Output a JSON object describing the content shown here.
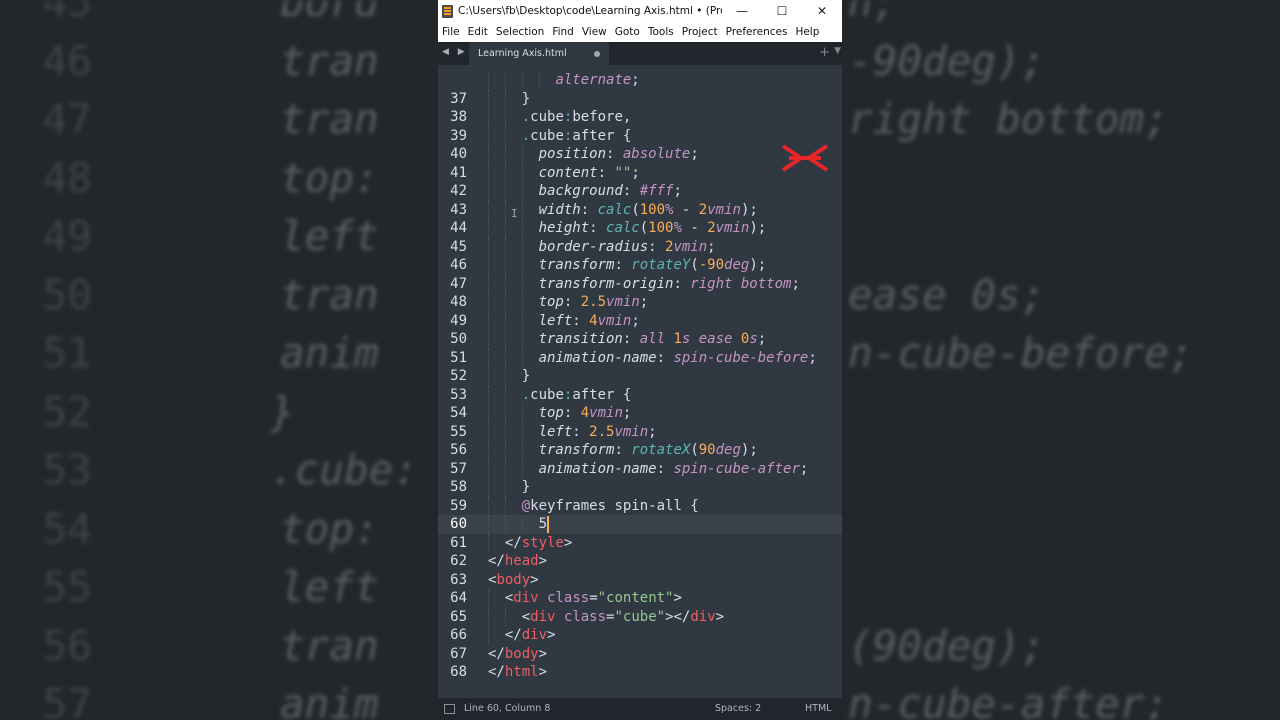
{
  "window": {
    "title": "C:\\Users\\fb\\Desktop\\code\\Learning Axis.html • (Project) - Su...",
    "minimize": "—",
    "maximize": "☐",
    "close": "✕"
  },
  "menu": [
    "File",
    "Edit",
    "Selection",
    "Find",
    "View",
    "Goto",
    "Tools",
    "Project",
    "Preferences",
    "Help"
  ],
  "tab": {
    "label": "Learning Axis.html",
    "nav_arrows": "◀ ▶",
    "plus": "+",
    "dropdown": "▼"
  },
  "status": {
    "position": "Line 60, Column 8",
    "spaces": "Spaces: 2",
    "syntax": "HTML"
  },
  "colors": {
    "editor_bg": "#303841",
    "chrome_bg": "#20262b",
    "property": "#d8dee9",
    "value_keyword": "#c594c5",
    "function": "#5fb3b3",
    "number": "#f9ae58",
    "string": "#99c794",
    "tag": "#ec5f66",
    "logo": "#e8262a"
  },
  "editor": {
    "current_line": 60,
    "lines": [
      {
        "n": "",
        "indent": 4,
        "tokens": [
          [
            "v",
            "alternate"
          ],
          [
            "w",
            ";"
          ]
        ]
      },
      {
        "n": "37",
        "indent": 2,
        "tokens": [
          [
            "w",
            "}"
          ]
        ]
      },
      {
        "n": "38",
        "indent": 2,
        "tokens": [
          [
            "pc",
            "."
          ],
          [
            "w",
            "cube"
          ],
          [
            "pc",
            ":"
          ],
          [
            "w",
            "before,"
          ]
        ]
      },
      {
        "n": "39",
        "indent": 2,
        "tokens": [
          [
            "pc",
            "."
          ],
          [
            "w",
            "cube"
          ],
          [
            "pc",
            ":"
          ],
          [
            "w",
            "after {"
          ]
        ]
      },
      {
        "n": "40",
        "indent": 3,
        "tokens": [
          [
            "p",
            "position"
          ],
          [
            "w",
            ": "
          ],
          [
            "v",
            "absolute"
          ],
          [
            "w",
            ";"
          ]
        ]
      },
      {
        "n": "41",
        "indent": 3,
        "tokens": [
          [
            "p",
            "content"
          ],
          [
            "w",
            ": "
          ],
          [
            "s",
            "\"\""
          ],
          [
            "w",
            ";"
          ]
        ]
      },
      {
        "n": "42",
        "indent": 3,
        "tokens": [
          [
            "p",
            "background"
          ],
          [
            "w",
            ": "
          ],
          [
            "v",
            "#fff"
          ],
          [
            "w",
            ";"
          ]
        ]
      },
      {
        "n": "43",
        "indent": 3,
        "tokens": [
          [
            "p",
            "width"
          ],
          [
            "w",
            ": "
          ],
          [
            "f",
            "calc"
          ],
          [
            "w",
            "("
          ],
          [
            "n",
            "100"
          ],
          [
            "u",
            "%"
          ],
          [
            "w",
            " - "
          ],
          [
            "n",
            "2"
          ],
          [
            "u",
            "vmin"
          ],
          [
            "w",
            ");"
          ]
        ]
      },
      {
        "n": "44",
        "indent": 3,
        "tokens": [
          [
            "p",
            "height"
          ],
          [
            "w",
            ": "
          ],
          [
            "f",
            "calc"
          ],
          [
            "w",
            "("
          ],
          [
            "n",
            "100"
          ],
          [
            "u",
            "%"
          ],
          [
            "w",
            " - "
          ],
          [
            "n",
            "2"
          ],
          [
            "u",
            "vmin"
          ],
          [
            "w",
            ");"
          ]
        ]
      },
      {
        "n": "45",
        "indent": 3,
        "tokens": [
          [
            "p",
            "border-radius"
          ],
          [
            "w",
            ": "
          ],
          [
            "n",
            "2"
          ],
          [
            "u",
            "vmin"
          ],
          [
            "w",
            ";"
          ]
        ]
      },
      {
        "n": "46",
        "indent": 3,
        "tokens": [
          [
            "p",
            "transform"
          ],
          [
            "w",
            ": "
          ],
          [
            "f",
            "rotateY"
          ],
          [
            "w",
            "("
          ],
          [
            "n",
            "-90"
          ],
          [
            "u",
            "deg"
          ],
          [
            "w",
            ");"
          ]
        ]
      },
      {
        "n": "47",
        "indent": 3,
        "tokens": [
          [
            "p",
            "transform-origin"
          ],
          [
            "w",
            ": "
          ],
          [
            "v",
            "right bottom"
          ],
          [
            "w",
            ";"
          ]
        ]
      },
      {
        "n": "48",
        "indent": 3,
        "tokens": [
          [
            "p",
            "top"
          ],
          [
            "w",
            ": "
          ],
          [
            "n",
            "2.5"
          ],
          [
            "u",
            "vmin"
          ],
          [
            "w",
            ";"
          ]
        ]
      },
      {
        "n": "49",
        "indent": 3,
        "tokens": [
          [
            "p",
            "left"
          ],
          [
            "w",
            ": "
          ],
          [
            "n",
            "4"
          ],
          [
            "u",
            "vmin"
          ],
          [
            "w",
            ";"
          ]
        ]
      },
      {
        "n": "50",
        "indent": 3,
        "tokens": [
          [
            "p",
            "transition"
          ],
          [
            "w",
            ": "
          ],
          [
            "v",
            "all "
          ],
          [
            "n",
            "1"
          ],
          [
            "u",
            "s"
          ],
          [
            "v",
            " ease "
          ],
          [
            "n",
            "0"
          ],
          [
            "u",
            "s"
          ],
          [
            "w",
            ";"
          ]
        ]
      },
      {
        "n": "51",
        "indent": 3,
        "tokens": [
          [
            "p",
            "animation-name"
          ],
          [
            "w",
            ": "
          ],
          [
            "v",
            "spin-cube-before"
          ],
          [
            "w",
            ";"
          ]
        ]
      },
      {
        "n": "52",
        "indent": 2,
        "tokens": [
          [
            "w",
            "}"
          ]
        ]
      },
      {
        "n": "53",
        "indent": 2,
        "tokens": [
          [
            "pc",
            "."
          ],
          [
            "w",
            "cube"
          ],
          [
            "pc",
            ":"
          ],
          [
            "w",
            "after {"
          ]
        ]
      },
      {
        "n": "54",
        "indent": 3,
        "tokens": [
          [
            "p",
            "top"
          ],
          [
            "w",
            ": "
          ],
          [
            "n",
            "4"
          ],
          [
            "u",
            "vmin"
          ],
          [
            "w",
            ";"
          ]
        ]
      },
      {
        "n": "55",
        "indent": 3,
        "tokens": [
          [
            "p",
            "left"
          ],
          [
            "w",
            ": "
          ],
          [
            "n",
            "2.5"
          ],
          [
            "u",
            "vmin"
          ],
          [
            "w",
            ";"
          ]
        ]
      },
      {
        "n": "56",
        "indent": 3,
        "tokens": [
          [
            "p",
            "transform"
          ],
          [
            "w",
            ": "
          ],
          [
            "f",
            "rotateX"
          ],
          [
            "w",
            "("
          ],
          [
            "n",
            "90"
          ],
          [
            "u",
            "deg"
          ],
          [
            "w",
            ");"
          ]
        ]
      },
      {
        "n": "57",
        "indent": 3,
        "tokens": [
          [
            "p",
            "animation-name"
          ],
          [
            "w",
            ": "
          ],
          [
            "v",
            "spin-cube-after"
          ],
          [
            "w",
            ";"
          ]
        ]
      },
      {
        "n": "58",
        "indent": 2,
        "tokens": [
          [
            "w",
            "}"
          ]
        ]
      },
      {
        "n": "59",
        "indent": 2,
        "tokens": [
          [
            "k",
            "@"
          ],
          [
            "w",
            "keyframes spin-all {"
          ]
        ]
      },
      {
        "n": "60",
        "indent": 3,
        "tokens": [
          [
            "w",
            "5"
          ]
        ]
      },
      {
        "n": "61",
        "indent": 1,
        "tokens": [
          [
            "w",
            "</"
          ],
          [
            "t",
            "style"
          ],
          [
            "w",
            ">"
          ]
        ]
      },
      {
        "n": "62",
        "indent": 0,
        "tokens": [
          [
            "w",
            "</"
          ],
          [
            "t",
            "head"
          ],
          [
            "w",
            ">"
          ]
        ]
      },
      {
        "n": "63",
        "indent": 0,
        "tokens": [
          [
            "w",
            "<"
          ],
          [
            "t",
            "body"
          ],
          [
            "w",
            ">"
          ]
        ]
      },
      {
        "n": "64",
        "indent": 1,
        "tokens": [
          [
            "w",
            "<"
          ],
          [
            "t",
            "div"
          ],
          [
            "w",
            " "
          ],
          [
            "a",
            "class"
          ],
          [
            "w",
            "="
          ],
          [
            "s",
            "\"content\""
          ],
          [
            "w",
            ">"
          ]
        ]
      },
      {
        "n": "65",
        "indent": 2,
        "tokens": [
          [
            "w",
            "<"
          ],
          [
            "t",
            "div"
          ],
          [
            "w",
            " "
          ],
          [
            "a",
            "class"
          ],
          [
            "w",
            "="
          ],
          [
            "s",
            "\"cube\""
          ],
          [
            "w",
            "></"
          ],
          [
            "t",
            "div"
          ],
          [
            "w",
            ">"
          ]
        ]
      },
      {
        "n": "66",
        "indent": 1,
        "tokens": [
          [
            "w",
            "</"
          ],
          [
            "t",
            "div"
          ],
          [
            "w",
            ">"
          ]
        ]
      },
      {
        "n": "67",
        "indent": 0,
        "tokens": [
          [
            "w",
            "</"
          ],
          [
            "t",
            "body"
          ],
          [
            "w",
            ">"
          ]
        ]
      },
      {
        "n": "68",
        "indent": 0,
        "tokens": [
          [
            "w",
            "</"
          ],
          [
            "t",
            "html"
          ],
          [
            "w",
            ">"
          ]
        ]
      }
    ]
  },
  "background": {
    "left_lines": [
      {
        "n": "45",
        "text": "bord"
      },
      {
        "n": "46",
        "text": "tran"
      },
      {
        "n": "47",
        "text": "tran"
      },
      {
        "n": "48",
        "text": "top:"
      },
      {
        "n": "49",
        "text": "left"
      },
      {
        "n": "50",
        "text": "tran"
      },
      {
        "n": "51",
        "text": "anim"
      },
      {
        "n": "52",
        "text": "}"
      },
      {
        "n": "53",
        "text": ".cube:"
      },
      {
        "n": "54",
        "text": "top:"
      },
      {
        "n": "55",
        "text": "left"
      },
      {
        "n": "56",
        "text": "tran"
      },
      {
        "n": "57",
        "text": "anim"
      }
    ],
    "right_lines": [
      "n;",
      "-90deg);",
      "right bottom;",
      "",
      "",
      "ease 0s;",
      "n-cube-before;",
      "",
      "",
      "",
      "",
      "(90deg);",
      "n-cube-after;"
    ]
  }
}
